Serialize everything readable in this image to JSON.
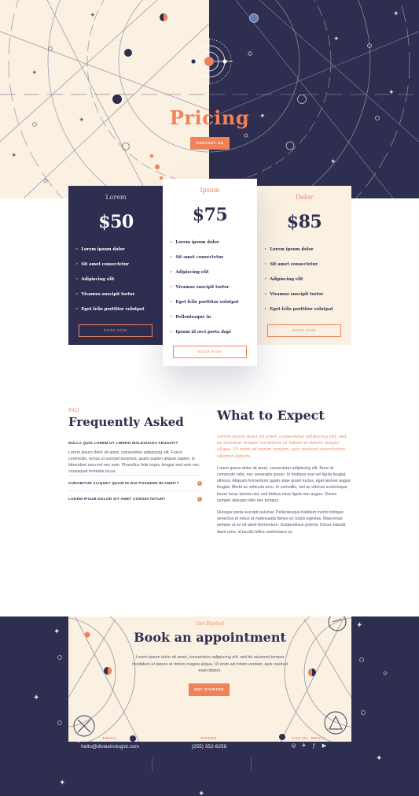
{
  "hero": {
    "title": "Pricing",
    "cta_label": "CONTACT US",
    "colors": {
      "cream": "#fbf1e3",
      "navy": "#2e2f50",
      "accent": "#f0825a"
    }
  },
  "pricing": {
    "plans": [
      {
        "name": "Lorem",
        "price": "$50",
        "features": [
          "Lorem ipsum dolor",
          "Sit amet consectetur",
          "Adipiscing elit",
          "Vivamus suscipit tortor",
          "Eget felis porttitor volutpat"
        ],
        "button_label": "BOOK NOW"
      },
      {
        "name": "Ipsum",
        "price": "$75",
        "features": [
          "Lorem ipsum dolor",
          "Sit amet consectetur",
          "Adipiscing elit",
          "Vivamus suscipit tortor",
          "Eget felis porttitor volutpat",
          "Pellentesque in",
          "Ipsum id orci porta dapi"
        ],
        "button_label": "BOOK NOW"
      },
      {
        "name": "Dolor",
        "price": "$85",
        "features": [
          "Lorem ipsum dolor",
          "Sit amet consectetur",
          "Adipiscing elit",
          "Vivamus suscipit tortor",
          "Eget felis porttitor volutpat"
        ],
        "button_label": "BOOK NOW"
      }
    ]
  },
  "faq": {
    "eyebrow": "FAQ",
    "title": "Frequently Asked",
    "open_question": "NULLA QUIS LOREM UT LIBERO MALESUADA FEUGIAT?",
    "open_answer": "Lorem ipsum dolor sit amet, consectetur adipiscing elit. Fusce commodo, lectus ut suscipit euismod, quam sapien aliquet sapien, in bibendum sem est nec sem. Phasellus felis turpis, feugiat sed sem nec, consequat molestie lacus.",
    "questions": [
      "CURABITUR ALIQUET QUAM ID DUI POSUERE BLANDIT?",
      "LOREM IPSUM DOLOR SIT AMET CONSECTETUR?"
    ],
    "toggle_icon": "plus-icon"
  },
  "expect": {
    "title": "What to Expect",
    "lead": "Lorem ipsum dolor sit amet, consectetur adipiscing elit, sed do eiusmod tempor incididunt ut labore et dolore magna aliqua. Ut enim ad minim veniam, quis nostrud exercitation ullamco laboris",
    "paragraphs": [
      "Lorem ipsum dolor sit amet, consectetur adipiscing elit. Nunc id commodo odio, nec venenatis ipsum. In tristique erat vel ligula feugiat ultrices. Aliquam fermentum quam vitae quam luctus, eget laoreet augue feugiat. Morbi ac vehicula arcu. In convallis, nisl ac ultrices scelerisque, lorem lacus lacinia nisl, sed finibus risus ligula non augue. Donec semper aliquam odio nec tempus.",
      "Quisque porta suscipit pulvinar. Pellentesque habitant morbi tristique senectus et netus et malesuada fames ac turpis egestas. Maecenas semper ut ex sit amet fermentum. Suspendisse potenti. Donec blandit diam urna, id iaculis tellus scelerisque ac."
    ]
  },
  "appointment": {
    "eyebrow": "Get Started",
    "title": "Book an appointment",
    "text": "Lorem ipsum dolor sit amet, consectetur adipiscing elit, sed do eiusmod tempor incididunt ut labore et dolore magna aliqua. Ut enim ad minim veniam, quis nostrud exercitation.",
    "button_label": "GET STARTED"
  },
  "footer": {
    "email_label": "EMAIL",
    "email": "hello@diviastrologist.com",
    "phone_label": "PHONE",
    "phone": "(255) 352-6258",
    "social_label": "SOCIAL MEDIA",
    "social_icons": [
      "instagram-icon",
      "twitter-icon",
      "facebook-icon",
      "youtube-icon"
    ]
  }
}
